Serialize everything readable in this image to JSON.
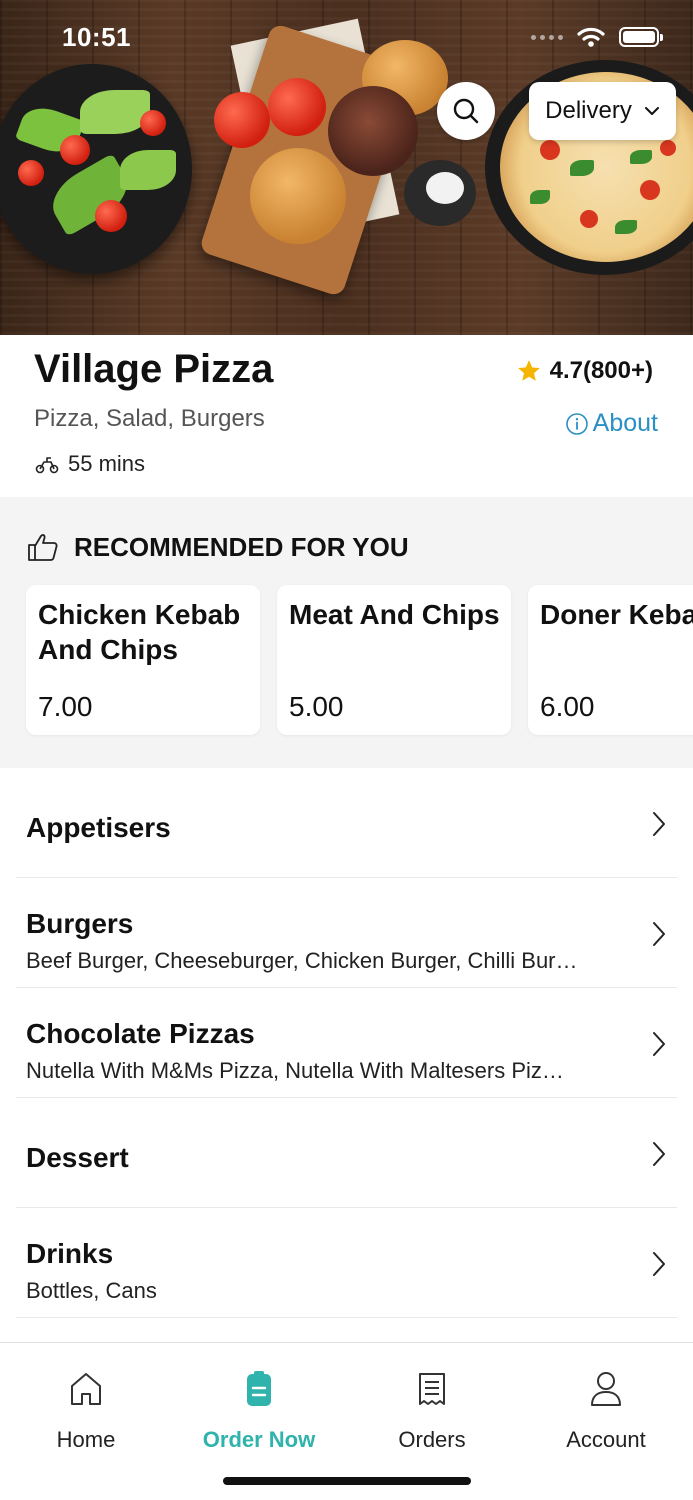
{
  "status": {
    "time": "10:51"
  },
  "hero": {
    "delivery_label": "Delivery",
    "icons": [
      "search-icon",
      "chevron-down-icon"
    ]
  },
  "restaurant": {
    "name": "Village Pizza",
    "rating": "4.7(800+)",
    "cuisine": "Pizza, Salad, Burgers",
    "about_label": "About",
    "eta": "55 mins"
  },
  "recommended": {
    "title": "RECOMMENDED FOR YOU",
    "items": [
      {
        "name": "Chicken Kebab And Chips",
        "price": "7.00"
      },
      {
        "name": "Meat And Chips",
        "price": "5.00"
      },
      {
        "name": "Doner Keba",
        "price": "6.00"
      }
    ]
  },
  "categories": [
    {
      "name": "Appetisers",
      "items": ""
    },
    {
      "name": "Burgers",
      "items": "Beef Burger, Cheeseburger, Chicken Burger, Chilli Bur…"
    },
    {
      "name": "Chocolate Pizzas",
      "items": "Nutella With M&Ms Pizza, Nutella With Maltesers Piz…"
    },
    {
      "name": "Dessert",
      "items": ""
    },
    {
      "name": "Drinks",
      "items": "Bottles, Cans"
    }
  ],
  "nav": {
    "home": "Home",
    "order_now": "Order Now",
    "orders": "Orders",
    "account": "Account",
    "active": "order_now"
  },
  "colors": {
    "accent": "#2fb3ac",
    "link": "#2a8fc4",
    "star": "#f5b400"
  }
}
